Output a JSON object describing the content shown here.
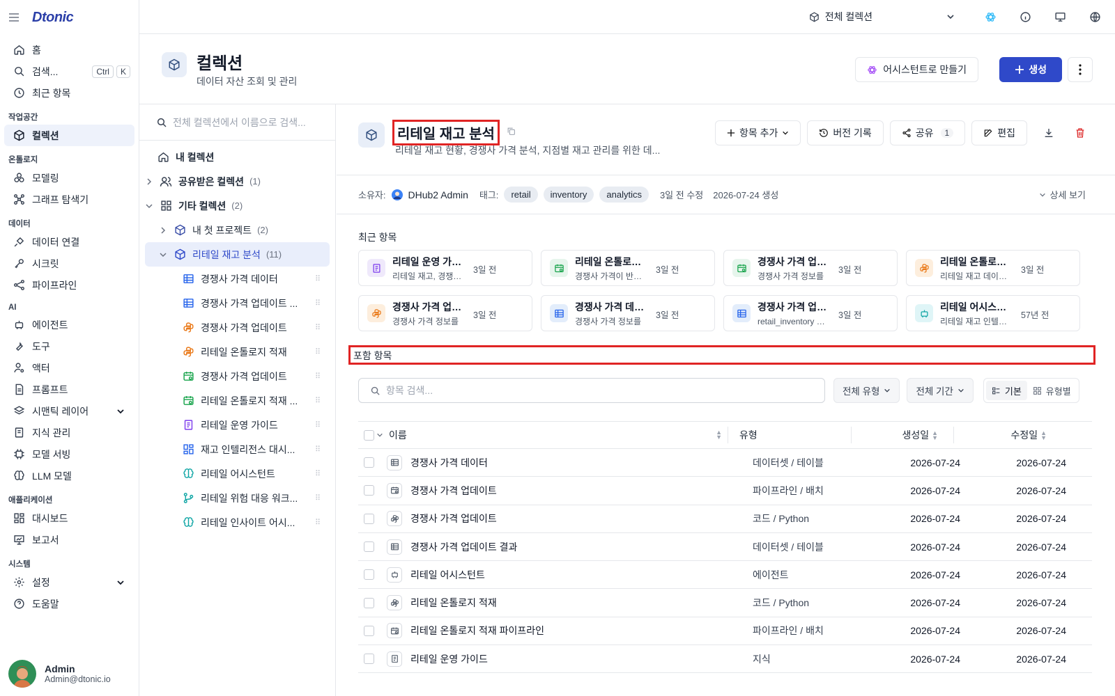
{
  "nav": {
    "logo": "Dtonic",
    "home": "홈",
    "search": "검색...",
    "kbd_ctrl": "Ctrl",
    "kbd_k": "K",
    "recent": "최근 항목",
    "sec_workspace": "작업공간",
    "collections": "컬렉션",
    "sec_ontology": "온톨로지",
    "modeling": "모델링",
    "graph": "그래프 탐색기",
    "sec_data": "데이터",
    "data_conn": "데이터 연결",
    "secrets": "시크릿",
    "pipeline": "파이프라인",
    "sec_ai": "AI",
    "agent": "에이전트",
    "tools": "도구",
    "actor": "액터",
    "prompt": "프롬프트",
    "semantic": "시맨틱 레이어",
    "knowledge": "지식 관리",
    "serving": "모델 서빙",
    "llm": "LLM 모델",
    "sec_app": "애플리케이션",
    "dashboard": "대시보드",
    "report": "보고서",
    "sec_system": "시스템",
    "settings": "설정",
    "help": "도움말",
    "user_name": "Admin",
    "user_email": "Admin@dtonic.io"
  },
  "topbar": {
    "collection_select": "전체 컬렉션"
  },
  "header": {
    "title": "컬렉션",
    "subtitle": "데이터 자산 조회 및 관리",
    "assist_btn": "어시스턴트로 만들기",
    "create_btn": "생성"
  },
  "tree": {
    "search_placeholder": "전체 컬렉션에서 이름으로 검색...",
    "my": "내 컬렉션",
    "shared": "공유받은 컬렉션",
    "shared_count": "(1)",
    "other": "기타 컬렉션",
    "other_count": "(2)",
    "proj": "내 첫 프로젝트",
    "proj_count": "(2)",
    "retail": "리테일 재고 분석",
    "retail_count": "(11)",
    "children": [
      {
        "label": "경쟁사 가격 데이터",
        "kind": "table"
      },
      {
        "label": "경쟁사 가격 업데이트 ...",
        "kind": "table"
      },
      {
        "label": "경쟁사 가격 업데이트",
        "kind": "python"
      },
      {
        "label": "리테일 온톨로지 적재",
        "kind": "python"
      },
      {
        "label": "경쟁사 가격 업데이트",
        "kind": "pipeline"
      },
      {
        "label": "리테일 온톨로지 적재 ...",
        "kind": "pipeline"
      },
      {
        "label": "리테일 운영 가이드",
        "kind": "doc"
      },
      {
        "label": "재고 인텔리전스 대시...",
        "kind": "dashboard"
      },
      {
        "label": "리테일 어시스턴트",
        "kind": "brain"
      },
      {
        "label": "리테일 위험 대응 워크...",
        "kind": "flow"
      },
      {
        "label": "리테일 인사이트 어시...",
        "kind": "brain"
      }
    ]
  },
  "detail": {
    "title": "리테일 재고 분석",
    "desc": "리테일 재고 현황, 경쟁사 가격 분석, 지점별 재고 관리를 위한 데...",
    "add_btn": "항목 추가",
    "history_btn": "버전 기록",
    "share_btn": "공유",
    "share_count": "1",
    "edit_btn": "편집",
    "owner_label": "소유자:",
    "owner": "DHub2 Admin",
    "tag_label": "태그:",
    "tags": [
      "retail",
      "inventory",
      "analytics"
    ],
    "modified": "3일 전 수정",
    "created": "2026-07-24 생성",
    "detail_more": "상세 보기",
    "recent_title": "최근 항목",
    "recent": [
      {
        "title": "리테일 운영 가이드",
        "sub": "리테일 재고, 경쟁사 가격",
        "time": "3일 전",
        "kind": "doc"
      },
      {
        "title": "리테일 온톨로지 적재",
        "sub": "경쟁사 가격이 반영된",
        "time": "3일 전",
        "kind": "pipeline"
      },
      {
        "title": "경쟁사 가격 업데이트",
        "sub": "경쟁사 가격 정보를",
        "time": "3일 전",
        "kind": "pipeline"
      },
      {
        "title": "리테일 온톨로지 적재",
        "sub": "리테일 재고 데이터를",
        "time": "3일 전",
        "kind": "python"
      },
      {
        "title": "경쟁사 가격 업데이트",
        "sub": "경쟁사 가격 정보를",
        "time": "3일 전",
        "kind": "python"
      },
      {
        "title": "경쟁사 가격 데이터",
        "sub": "경쟁사 가격 정보를",
        "time": "3일 전",
        "kind": "table"
      },
      {
        "title": "경쟁사 가격 업데이트 결과",
        "sub": "retail_inventory 데이터",
        "time": "3일 전",
        "kind": "table"
      },
      {
        "title": "리테일 어시스턴트",
        "sub": "리테일 재고 인텔리전스",
        "time": "57년 전",
        "kind": "agent"
      }
    ],
    "included_title": "포함 항목",
    "item_search": "항목 검색...",
    "type_filter": "전체 유형",
    "period_filter": "전체 기간",
    "view_basic": "기본",
    "view_bytype": "유형별",
    "cols": {
      "name": "이름",
      "type": "유형",
      "created": "생성일",
      "updated": "수정일"
    },
    "rows": [
      {
        "name": "경쟁사 가격 데이터",
        "type": "데이터셋 / 테이블",
        "created": "2026-07-24",
        "updated": "2026-07-24",
        "kind": "table"
      },
      {
        "name": "경쟁사 가격 업데이트",
        "type": "파이프라인 / 배치",
        "created": "2026-07-24",
        "updated": "2026-07-24",
        "kind": "pipeline"
      },
      {
        "name": "경쟁사 가격 업데이트",
        "type": "코드 / Python",
        "created": "2026-07-24",
        "updated": "2026-07-24",
        "kind": "python"
      },
      {
        "name": "경쟁사 가격 업데이트 결과",
        "type": "데이터셋 / 테이블",
        "created": "2026-07-24",
        "updated": "2026-07-24",
        "kind": "table"
      },
      {
        "name": "리테일 어시스턴트",
        "type": "에이전트",
        "created": "2026-07-24",
        "updated": "2026-07-24",
        "kind": "agent"
      },
      {
        "name": "리테일 온톨로지 적재",
        "type": "코드 / Python",
        "created": "2026-07-24",
        "updated": "2026-07-24",
        "kind": "python"
      },
      {
        "name": "리테일 온톨로지 적재 파이프라인",
        "type": "파이프라인 / 배치",
        "created": "2026-07-24",
        "updated": "2026-07-24",
        "kind": "pipeline"
      },
      {
        "name": "리테일 운영 가이드",
        "type": "지식",
        "created": "2026-07-24",
        "updated": "2026-07-24",
        "kind": "doc"
      }
    ]
  },
  "colors": {
    "accent": "#2f49c9",
    "highlight": "#e02424",
    "selected_bg": "#e9eefb"
  }
}
